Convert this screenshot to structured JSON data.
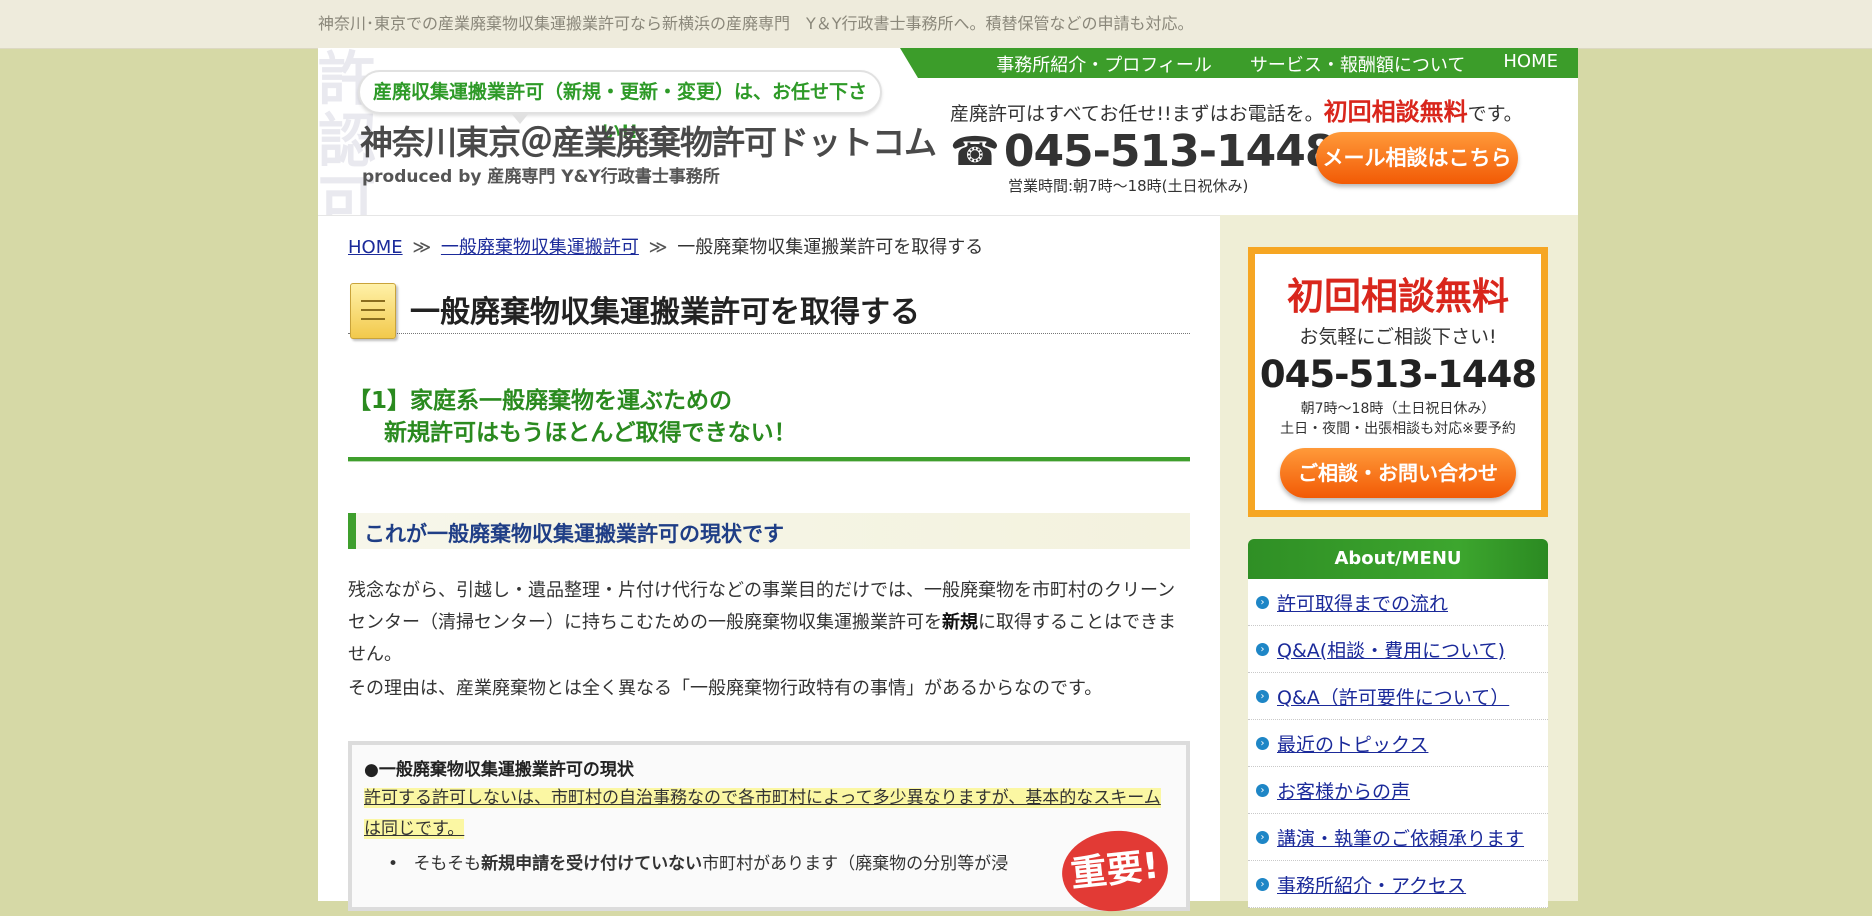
{
  "topbar": {
    "text": "神奈川･東京での産業廃棄物収集運搬業許可なら新横浜の産廃専門　Y＆Y行政書士事務所へ。積替保管などの申請も対応。"
  },
  "header": {
    "tagline": "産廃収集運搬業許可（新規・更新・変更）は、お任せ下さい!!",
    "site_title": "神奈川東京＠産業廃棄物許可ドットコム",
    "produced_by": "produced by 産廃専門 Y&Y行政書士事務所",
    "nav": [
      "事務所紹介・プロフィール",
      "サービス・報酬額について",
      "HOME"
    ],
    "lead_prefix": "産廃許可はすべてお任せ!!まずはお電話を。",
    "lead_highlight": "初回相談無料",
    "lead_suffix": "です。",
    "phone": "045-513-1448",
    "hours": "営業時間:朝7時～18時(土日祝休み)",
    "mail_button": "メール相談はこちら"
  },
  "breadcrumb": {
    "home": "HOME",
    "parent": "一般廃棄物収集運搬許可",
    "current": "一般廃棄物収集運搬業許可を取得する",
    "sep": "≫"
  },
  "main": {
    "page_title": "一般廃棄物収集運搬業許可を取得する",
    "section1_line1": "【1】家庭系一般廃棄物を運ぶための",
    "section1_line2": "新規許可はもうほとんど取得できない！",
    "section2_title": "これが一般廃棄物収集運搬業許可の現状です",
    "para1_a": "残念ながら、引越し・遺品整理・片付け代行などの事業目的だけでは、一般廃棄物を市町村のクリーンセンター（清掃センター）に持ちこむための一般廃棄物収集運搬業許可を",
    "para1_bold": "新規",
    "para1_b": "に取得することはできません。",
    "para2": "その理由は、産業廃棄物とは全く異なる「一般廃棄物行政特有の事情」があるからなのです。",
    "box_title": "●一般廃棄物収集運搬業許可の現状",
    "box_highlight": "許可する許可しないは、市町村の自治事務なので各市町村によって多少異なりますが、基本的なスキームは同じです。",
    "box_bullet_a": "そもそも",
    "box_bullet_bold": "新規申請を受け付けていない",
    "box_bullet_b": "市町村があります（廃棄物の分別等が浸",
    "badge": "重要!"
  },
  "sidebar": {
    "free": "初回相談無料",
    "sub": "お気軽にご相談下さい!",
    "phone": "045-513-1448",
    "hours": "朝7時～18時（土日祝日休み）",
    "note": "土日・夜間・出張相談も対応※要予約",
    "button": "ご相談・お問い合わせ",
    "menu_title": "About/MENU",
    "menu": [
      "許可取得までの流れ",
      "Q&A(相談・費用について)",
      "Q&A（許可要件について）",
      "最近のトピックス",
      "お客様からの声",
      "講演・執筆のご依頼承ります",
      "事務所紹介・アクセス"
    ]
  }
}
